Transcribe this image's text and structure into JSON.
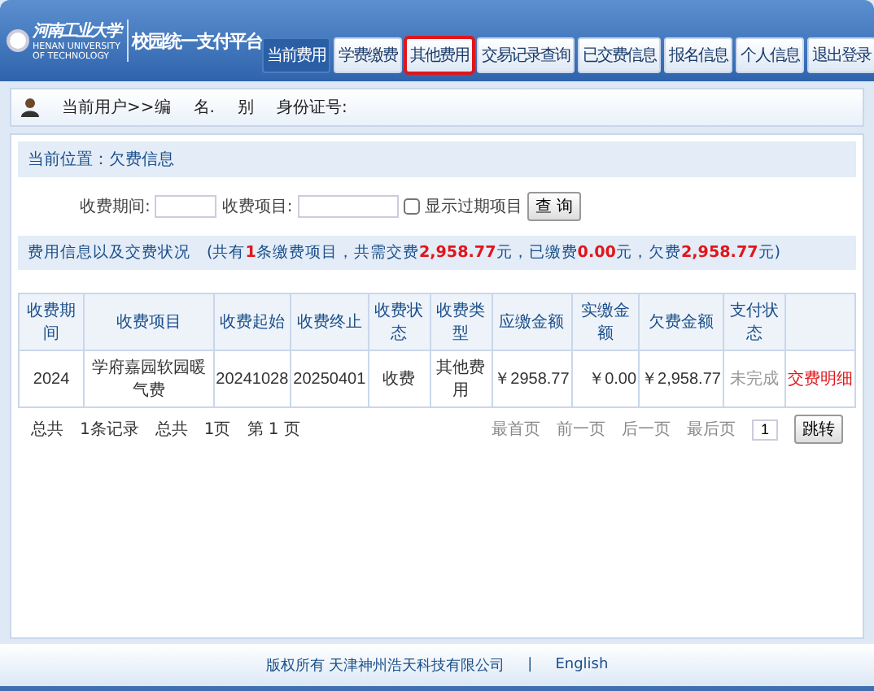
{
  "header": {
    "logo_text": "河南工业大学",
    "logo_subtext": "HENAN UNIVERSITY OF TECHNOLOGY",
    "title": "校园统一支付平台",
    "tabs": [
      {
        "label": "当前费用",
        "selected": true,
        "highlighted": false
      },
      {
        "label": "学费缴费",
        "selected": false,
        "highlighted": false
      },
      {
        "label": "其他费用",
        "selected": false,
        "highlighted": true
      },
      {
        "label": "交易记录查询",
        "selected": false,
        "highlighted": false
      },
      {
        "label": "已交费信息",
        "selected": false,
        "highlighted": false
      },
      {
        "label": "报名信息",
        "selected": false,
        "highlighted": false
      },
      {
        "label": "个人信息",
        "selected": false,
        "highlighted": false
      },
      {
        "label": "退出登录",
        "selected": false,
        "highlighted": false
      }
    ]
  },
  "user_bar": {
    "fields": [
      "当前用户>>编",
      "名.",
      "别",
      "身份证号:"
    ]
  },
  "location": "当前位置：欠费信息",
  "filter": {
    "period_label": "收费期间:",
    "item_label": "收费项目:",
    "show_expired": {
      "label": "显示过期项目",
      "checked": false
    },
    "button": "查 询"
  },
  "summary": "费用信息以及交费状况　(共有**1**条缴费项目，共需交费**2,958.77**元，已缴费**0.00**元，欠费**2,958.77**元)",
  "table": {
    "columns": [
      "收费期间",
      "收费项目",
      "收费起始",
      "收费终止",
      "收费状态",
      "收费类型",
      "应缴金额",
      "实缴金额",
      "欠费金额",
      "支付状态",
      ""
    ],
    "rows": [
      {
        "cells": [
          "2024",
          "学府嘉园软园暖气费",
          "20241028",
          "20250401",
          "收费",
          "其他费用",
          "￥2958.77",
          "￥0.00",
          "￥2,958.77",
          "未完成"
        ],
        "action": "交费明细"
      }
    ]
  },
  "pager": {
    "total_records": "总共　1条记录",
    "total_pages": "总共　1页",
    "current_page": "第 1 页",
    "links": [
      "最首页",
      "前一页",
      "后一页",
      "最后页"
    ],
    "page_value": "1",
    "go": "跳转"
  },
  "footer": {
    "copyright": "版权所有 天津神州浩天科技有限公司",
    "separator": "|",
    "language": "English"
  }
}
